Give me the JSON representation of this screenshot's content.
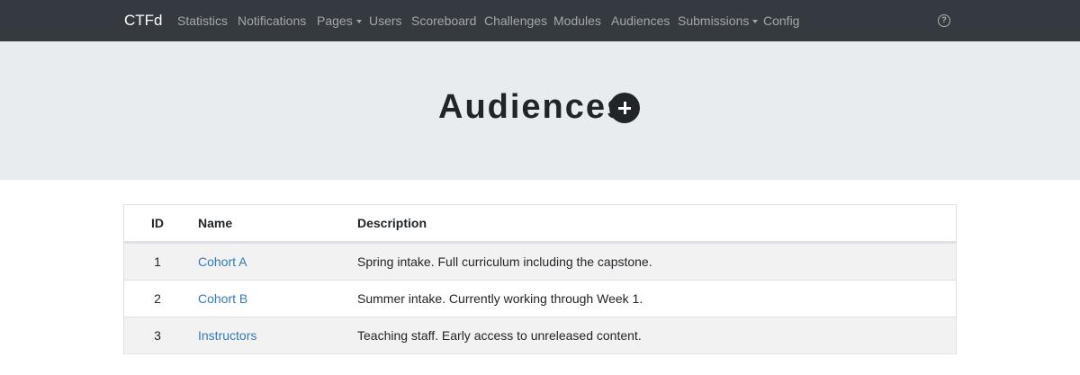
{
  "navbar": {
    "brand": "CTFd",
    "items": [
      {
        "label": "Statistics"
      },
      {
        "label": "Notifications"
      },
      {
        "label": "Pages"
      },
      {
        "label": "Users"
      },
      {
        "label": "Scoreboard"
      },
      {
        "label": "Challenges"
      },
      {
        "label": "Modules"
      },
      {
        "label": "Audiences"
      },
      {
        "label": "Submissions"
      },
      {
        "label": "Config"
      }
    ],
    "help_icon": "question-circle-icon"
  },
  "header": {
    "title": "Audiences",
    "add_icon": "plus-circle-icon"
  },
  "table": {
    "columns": [
      "ID",
      "Name",
      "Description"
    ],
    "rows": [
      {
        "id": "1",
        "name": "Cohort A",
        "description": "Spring intake. Full curriculum including the capstone."
      },
      {
        "id": "2",
        "name": "Cohort B",
        "description": "Summer intake. Currently working through Week 1."
      },
      {
        "id": "3",
        "name": "Instructors",
        "description": "Teaching staff. Early access to unreleased content."
      }
    ]
  },
  "colors": {
    "navbar_bg": "#343a40",
    "jumbotron_bg": "#e9ecef",
    "link": "#337ab7",
    "stripe": "#f2f2f2"
  }
}
